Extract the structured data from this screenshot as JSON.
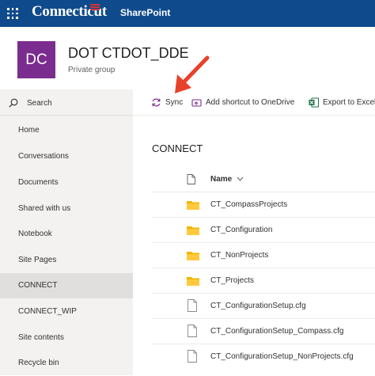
{
  "suite_bar": {
    "brand": "Connecticut",
    "app_name": "SharePoint"
  },
  "site": {
    "logo_initials": "DC",
    "title": "DOT CTDOT_DDE",
    "subtitle": "Private group"
  },
  "search": {
    "label": "Search"
  },
  "nav": {
    "items": [
      {
        "label": "Home"
      },
      {
        "label": "Conversations"
      },
      {
        "label": "Documents"
      },
      {
        "label": "Shared with us"
      },
      {
        "label": "Notebook"
      },
      {
        "label": "Site Pages"
      },
      {
        "label": "CONNECT",
        "selected": true
      },
      {
        "label": "CONNECT_WIP"
      },
      {
        "label": "Site contents"
      },
      {
        "label": "Recycle bin"
      }
    ]
  },
  "command_bar": {
    "sync": "Sync",
    "add_shortcut": "Add shortcut to OneDrive",
    "export": "Export to Excel"
  },
  "library": {
    "title": "CONNECT",
    "column_name": "Name",
    "rows": [
      {
        "name": "CT_CompassProjects",
        "type": "folder"
      },
      {
        "name": "CT_Configuration",
        "type": "folder"
      },
      {
        "name": "CT_NonProjects",
        "type": "folder"
      },
      {
        "name": "CT_Projects",
        "type": "folder"
      },
      {
        "name": "CT_ConfigurationSetup.cfg",
        "type": "file"
      },
      {
        "name": "CT_ConfigurationSetup_Compass.cfg",
        "type": "file"
      },
      {
        "name": "CT_ConfigurationSetup_NonProjects.cfg",
        "type": "file"
      }
    ]
  },
  "colors": {
    "suite_bar": "#0f4b8c",
    "logo": "#7b2c8f",
    "folder": "#f0b400",
    "annotation_arrow": "#e8412a"
  }
}
